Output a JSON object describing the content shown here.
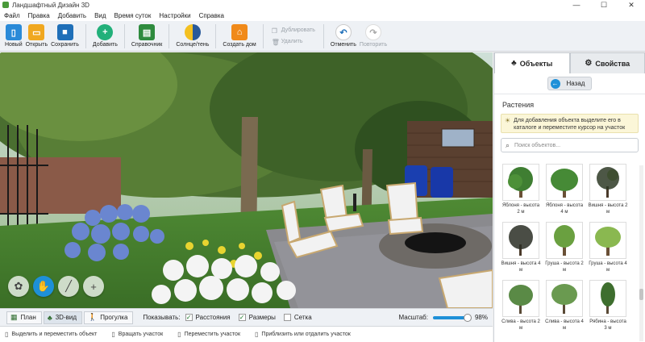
{
  "window": {
    "title": "Ландшафтный Дизайн 3D",
    "controls": [
      "—",
      "☐",
      "✕"
    ]
  },
  "menu": [
    "Файл",
    "Правка",
    "Добавить",
    "Вид",
    "Время суток",
    "Настройки",
    "Справка"
  ],
  "toolbar": {
    "new": "Новый",
    "open": "Открыть",
    "save": "Сохранить",
    "add": "Добавить",
    "reference": "Справочник",
    "sun_shade": "Солнце/тень",
    "create_house": "Создать дом",
    "duplicate": "Дублировать",
    "delete": "Удалить",
    "undo": "Отменить",
    "redo": "Повторить"
  },
  "panel": {
    "tab_objects": "Объекты",
    "tab_properties": "Свойства",
    "back": "Назад",
    "section": "Растения",
    "hint": "Для добавления объекта выделите его в каталоге и переместите курсор на участок",
    "search_placeholder": "Поиск объектов...",
    "items": [
      "Яблоня - высота 2 м",
      "Яблоня - высота 4 м",
      "Вишня - высота 2 м",
      "Вишня - высота 4 м",
      "Груша - высота 2 м",
      "Груша - высота 4 м",
      "Слива - высота 2 м",
      "Слива - высота 4 м",
      "Рябина - высота 3 м"
    ]
  },
  "viewbar": {
    "plan": "План",
    "view3d": "3D-вид",
    "walk": "Прогулка",
    "show": "Показывать:",
    "distances": "Расстояния",
    "sizes": "Размеры",
    "grid": "Сетка",
    "scale": "Масштаб:",
    "scale_value": "98%"
  },
  "status": {
    "select": "Выделить и переместить объект",
    "rotate": "Вращать участок",
    "move": "Переместить участок",
    "zoom": "Приблизить или отдалить участок"
  },
  "colors": {
    "accent": "#1e90d8",
    "toolbar_bg": "#eef1f5",
    "hint_bg": "#fbf6d8"
  }
}
